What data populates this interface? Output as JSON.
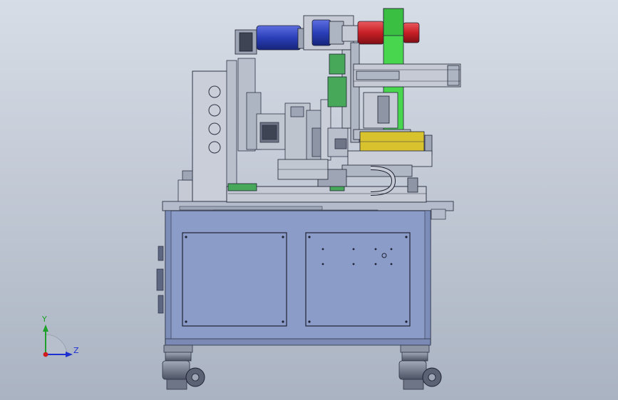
{
  "viewport": {
    "background_top": "#d7dde6",
    "background_bottom": "#aab3c2"
  },
  "triad": {
    "y_label": "Y",
    "z_label": "Z",
    "y_color": "#1fa02a",
    "z_color": "#1c2fd0",
    "x_color": "#d01c1c"
  },
  "colors": {
    "cabinet": "#8c9cc8",
    "cabinet_dark": "#6f7fab",
    "frame": "#b4bccb",
    "steel": "#c5cad4",
    "motor_blue": "#2a3fb8",
    "motor_red": "#c81f26",
    "wheel_green": "#49d64f",
    "green_part": "#47a85a",
    "yellow_part": "#d8c22e",
    "caster": "#6d7586"
  }
}
